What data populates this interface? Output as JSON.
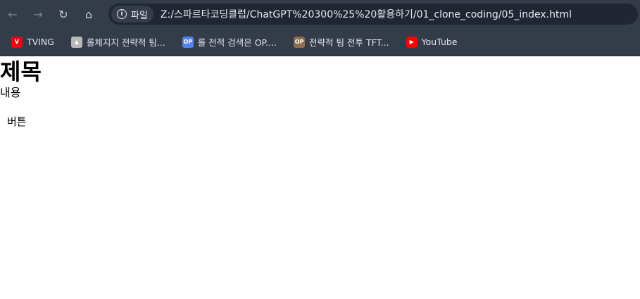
{
  "browser": {
    "site_chip_label": "파일",
    "url": "Z:/스파르타코딩클럽/ChatGPT%20300%25%20활용하기/01_clone_coding/05_index.html"
  },
  "bookmarks": [
    {
      "label": "TVING",
      "icon": "tving-icon",
      "color": "#e50914"
    },
    {
      "label": "롤체지지 전략적 팀...",
      "icon": "lolchess-icon",
      "color": "#d0d0d0"
    },
    {
      "label": "롤 전적 검색은 OP....",
      "icon": "opgg-icon",
      "color": "#5383e8"
    },
    {
      "label": "전략적 팀 전투 TFT...",
      "icon": "tft-icon",
      "color": "#8c6e4e"
    },
    {
      "label": "YouTube",
      "icon": "youtube-icon",
      "color": "#ff0000"
    }
  ],
  "page": {
    "title": "제목",
    "content": "내용",
    "button_label": "버튼"
  }
}
